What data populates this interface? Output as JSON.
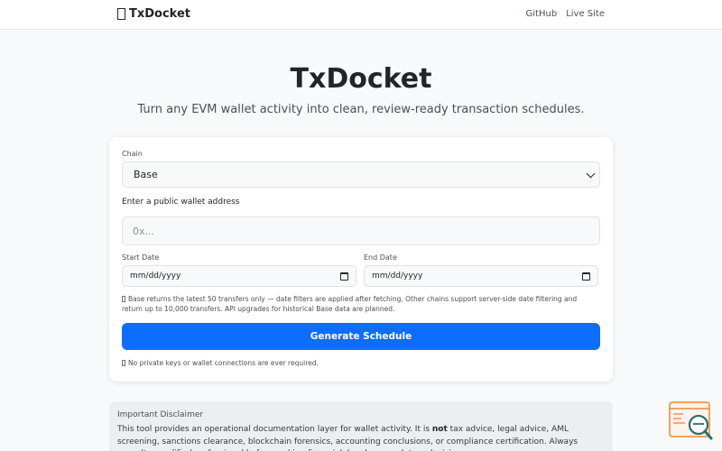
{
  "nav": {
    "brand": "TxDocket",
    "links": [
      "GitHub",
      "Live Site"
    ]
  },
  "hero": {
    "title": "TxDocket",
    "subtitle": "Turn any EVM wallet activity into clean, review-ready transaction schedules."
  },
  "form": {
    "chain_label": "Chain",
    "chain_selected": "Base",
    "address_label": "Enter a public wallet address",
    "address_placeholder": "0x...",
    "address_value": "",
    "start_label": "Start Date",
    "start_value": "mm/dd/yyyy",
    "end_label": "End Date",
    "end_value": "mm/dd/yyyy",
    "note": "Base returns the latest 50 transfers only — date filters are applied after fetching. Other chains support server-side date filtering and return up to 10,000 transfers. API upgrades for historical Base data are planned.",
    "submit_label": "Generate Schedule",
    "privacy": "No private keys or wallet connections are ever required."
  },
  "disclaimer": {
    "title": "Important Disclaimer",
    "text_before": "This tool provides an operational documentation layer for wallet activity. It is ",
    "text_bold": "not",
    "text_after": " tax advice, legal advice, AML screening, sanctions clearance, blockchain forensics, accounting conclusions, or compliance certification. Always consult a qualified professional before making financial, legal, or regulatory decisions."
  },
  "colors": {
    "primary": "#0d6efd",
    "widget_orange": "#e8893a",
    "widget_teal": "#2a6f6b"
  },
  "icons": {
    "brand": "document-icon",
    "chain_select": "chevron-down-icon",
    "date_picker": "calendar-icon",
    "note": "info-icon",
    "privacy": "lock-icon",
    "widget": "search-magnifier-icon"
  }
}
